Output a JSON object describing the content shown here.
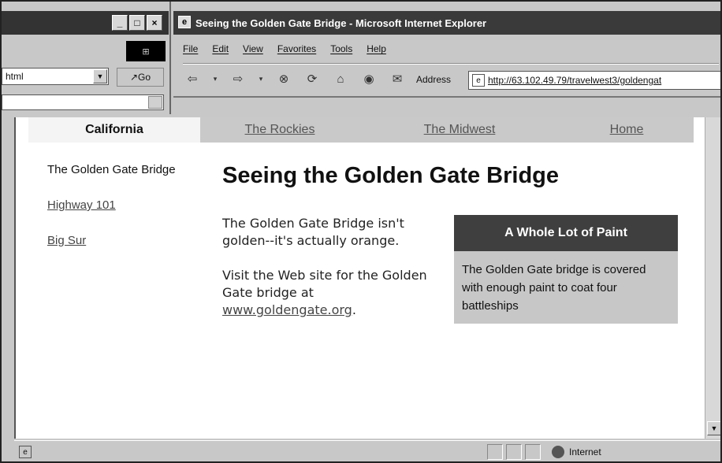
{
  "bg_window": {
    "controls": [
      "_",
      "□",
      "×"
    ],
    "address_partial": "html",
    "go_label": "Go"
  },
  "window": {
    "title": "Seeing the Golden Gate Bridge - Microsoft Internet Explorer"
  },
  "menu": [
    "File",
    "Edit",
    "View",
    "Favorites",
    "Tools",
    "Help"
  ],
  "toolbar": {
    "address_label": "Address",
    "address_value": "http://63.102.49.79/travelwest3/goldengat"
  },
  "nav_tabs": [
    {
      "label": "California"
    },
    {
      "label": "The Rockies"
    },
    {
      "label": "The Midwest"
    },
    {
      "label": "Home"
    }
  ],
  "sidebar": {
    "current": "The Golden Gate Bridge",
    "links": [
      "Highway 101",
      "Big Sur"
    ]
  },
  "page": {
    "heading": "Seeing the Golden Gate Bridge",
    "para1": "The Golden Gate Bridge isn't golden--it's actually orange.",
    "para2_before": "Visit the Web site for the Golden Gate bridge at ",
    "link_text": "www.goldengate.org",
    "para2_after": "."
  },
  "callout": {
    "title": "A Whole Lot of Paint",
    "body": "The Golden Gate bridge is covered with enough paint to coat four battleships"
  },
  "status": {
    "zone": "Internet"
  }
}
